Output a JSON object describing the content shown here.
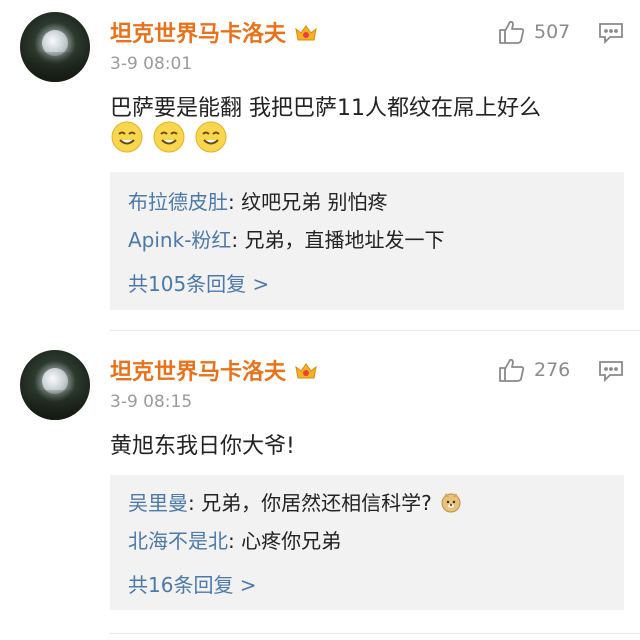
{
  "comments": [
    {
      "username": "坦克世界马卡洛夫",
      "time": "3-9 08:01",
      "likes": "507",
      "text": "巴萨要是能翻 我把巴萨11人都纹在屌上好么",
      "emoji_icons": [
        "grin-face-icon",
        "grin-face-icon",
        "grin-face-icon"
      ],
      "replies": [
        {
          "name": "布拉德皮肚",
          "sep": ": ",
          "text": "纹吧兄弟 别怕疼"
        },
        {
          "name": "Apink-粉红",
          "sep": ": ",
          "text": "兄弟，直播地址发一下"
        }
      ],
      "more_replies": "共105条回复 >"
    },
    {
      "username": "坦克世界马卡洛夫",
      "time": "3-9 08:15",
      "likes": "276",
      "text": "黄旭东我日你大爷!",
      "replies": [
        {
          "name": "吴里曼",
          "sep": ": ",
          "text": "兄弟，你居然还相信科学?",
          "icon": "doge-icon"
        },
        {
          "name": "北海不是北",
          "sep": ": ",
          "text": "心疼你兄弟"
        }
      ],
      "more_replies": "共16条回复 >"
    }
  ],
  "colors": {
    "username": "#e8721c",
    "reply_name": "#4d79a8",
    "reply_bg": "#f2f2f2",
    "meta": "#9a9a9a"
  },
  "icons": {
    "vip": "vip-crown-icon",
    "like": "thumbs-up-icon",
    "comment": "comment-bubble-icon"
  }
}
